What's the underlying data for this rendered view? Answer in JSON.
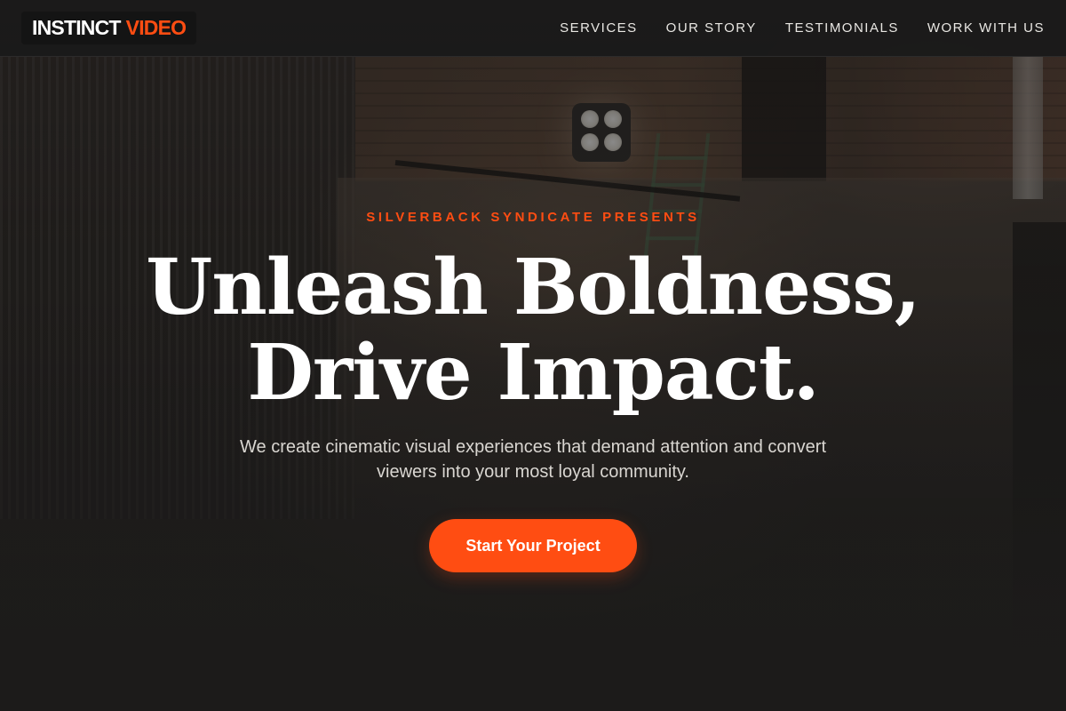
{
  "header": {
    "logo": {
      "word1": "INSTINCT",
      "word2": "VIDEO"
    },
    "nav": [
      {
        "label": "SERVICES"
      },
      {
        "label": "OUR STORY"
      },
      {
        "label": "TESTIMONIALS"
      },
      {
        "label": "WORK WITH US"
      }
    ]
  },
  "hero": {
    "eyebrow": "SILVERBACK SYNDICATE PRESENTS",
    "headline_line1": "Unleash Boldness,",
    "headline_line2": "Drive Impact.",
    "subtitle": "We create cinematic visual experiences that demand attention and convert viewers into your most loyal community.",
    "cta_label": "Start Your Project",
    "background_image": "film-set-photo"
  },
  "colors": {
    "accent": "#ff4d12",
    "background": "#1c1b1a",
    "header_bg": "#1a1a1a",
    "text_primary": "#ffffff",
    "text_secondary": "#d9d6d1"
  }
}
